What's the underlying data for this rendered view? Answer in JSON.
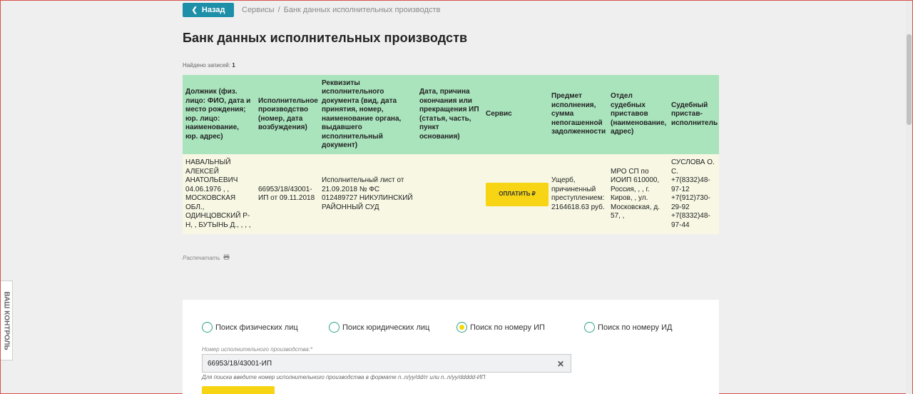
{
  "nav": {
    "back_label": "Назад",
    "breadcrumb": [
      "Сервисы",
      "/",
      "Банк данных исполнительных производств"
    ]
  },
  "page_title": "Банк данных исполнительных производств",
  "found": {
    "label": "Найдено записей:",
    "count": "1"
  },
  "table": {
    "headers": [
      "Должник (физ. лицо: ФИО, дата и место рождения; юр. лицо: наименование, юр. адрес)",
      "Исполнительное производство (номер, дата возбуждения)",
      "Реквизиты исполнительного документа (вид, дата принятия, номер, наименование органа, выдавшего исполнительный документ)",
      "Дата, причина окончания или прекращения ИП (статья, часть, пункт основания)",
      "Сервис",
      "Предмет исполнения, сумма непогашенной задолженности",
      "Отдел судебных приставов (наименование, адрес)",
      "Судебный пристав-исполнитель"
    ],
    "row": {
      "debtor": "НАВАЛЬНЫЙ АЛЕКСЕЙ АНАТОЛЬЕВИЧ 04.06.1976 , , МОСКОВСКАЯ ОБЛ., ОДИНЦОВСКИЙ Р-Н, , БУТЫНЬ Д., , , ,",
      "proceeding": "66953/18/43001-ИП от 09.11.2018",
      "document": "Исполнительный лист от 21.09.2018 № ФС 012489727 НИКУЛИНСКИЙ РАЙОННЫЙ СУД",
      "end_date": "",
      "service_button": "ОПЛАТИТЬ ₽",
      "subject": "Ущерб, причиненный преступлением: 2164618.63 руб.",
      "department": "МРО СП по ИОИП 610000, Россия, , , г. Киров, , ул. Московская, д. 57, ,",
      "bailiff": "СУСЛОВА О. С. +7(8332)48-97-12 +7(912)730-29-92 +7(8332)48-97-44"
    }
  },
  "print_label": "Распечатать",
  "search": {
    "options": [
      {
        "label": "Поиск физических лиц",
        "checked": false
      },
      {
        "label": "Поиск юридических лиц",
        "checked": false
      },
      {
        "label": "Поиск по номеру ИП",
        "checked": true
      },
      {
        "label": "Поиск по номеру ИД",
        "checked": false
      }
    ],
    "field_label": "Номер исполнительного производства:*",
    "field_value": "66953/18/43001-ИП",
    "hint": "Для поиска введите номер исполнительного производства в формате n..n/yy/dd/rr или n..n/yy/ddddd-ИП"
  },
  "side_tab": "ВАШ КОНТРОЛЬ",
  "colors": {
    "accent": "#1d8fa8",
    "header_green": "#a9e4bd",
    "row_bg": "#f7f7e4",
    "button_yellow": "#f7d515",
    "radio_border": "#2aa38a"
  }
}
